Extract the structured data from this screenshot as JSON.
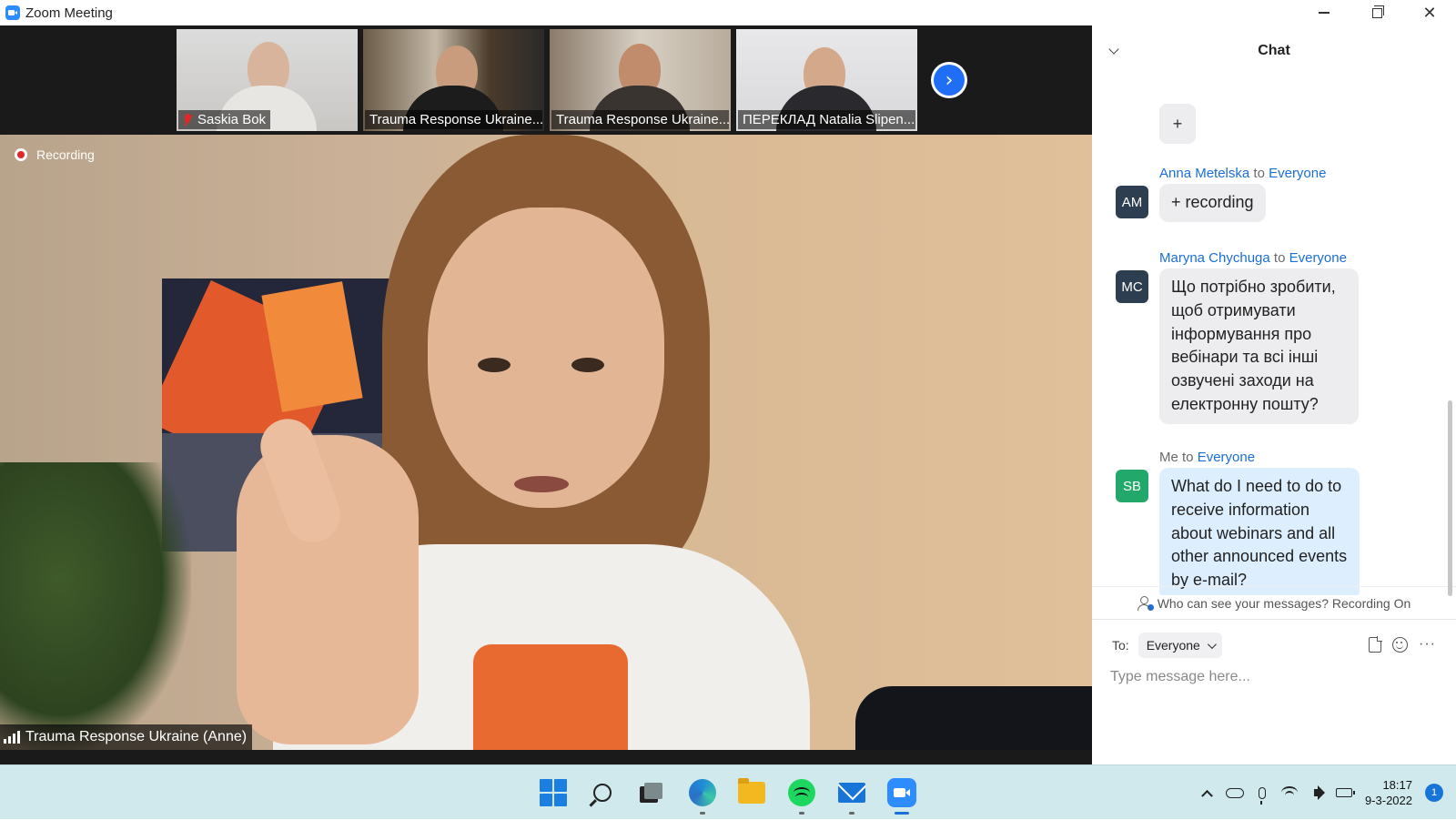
{
  "window": {
    "title": "Zoom Meeting"
  },
  "participants": [
    {
      "name": "Saskia Bok",
      "muted": true
    },
    {
      "name": "Trauma Response Ukraine...",
      "muted": false
    },
    {
      "name": "Trauma Response Ukraine...",
      "muted": false
    },
    {
      "name": "ПЕРЕКЛАД Natalia Slipen...",
      "muted": false
    }
  ],
  "recording": {
    "label": "Recording"
  },
  "active_speaker": {
    "name": "Trauma Response Ukraine (Anne)"
  },
  "chat": {
    "title": "Chat",
    "plus_label": "+",
    "messages": [
      {
        "sender": "Anna Metelska",
        "to_word": "to",
        "target": "Everyone",
        "initials": "AM",
        "avatar_color": "#2d3e50",
        "text": "+ recording"
      },
      {
        "sender": "Maryna Chychuga",
        "to_word": "to",
        "target": "Everyone",
        "initials": "MC",
        "avatar_color": "#2d3e50",
        "text": "Що потрібно зробити, щоб отримувати інформування про вебінари та всі інші озвучені заходи на електронну пошту?"
      },
      {
        "sender": "Me",
        "to_word": "to",
        "target": "Everyone",
        "initials": "SB",
        "avatar_color": "#23a86b",
        "text": "What do I need to do to receive information about webinars and all other announced events by e-mail?"
      }
    ],
    "visibility_note": "Who can see your messages? Recording On",
    "to_label": "To:",
    "recipient": "Everyone",
    "input_placeholder": "Type message here...",
    "more_label": "···"
  },
  "taskbar": {
    "time": "18:17",
    "date": "9-3-2022",
    "notifications": "1"
  },
  "colors": {
    "link_blue": "#1a6fd9",
    "zoom_blue": "#2D8CFF",
    "taskbar_bg": "#cfe9ec"
  }
}
